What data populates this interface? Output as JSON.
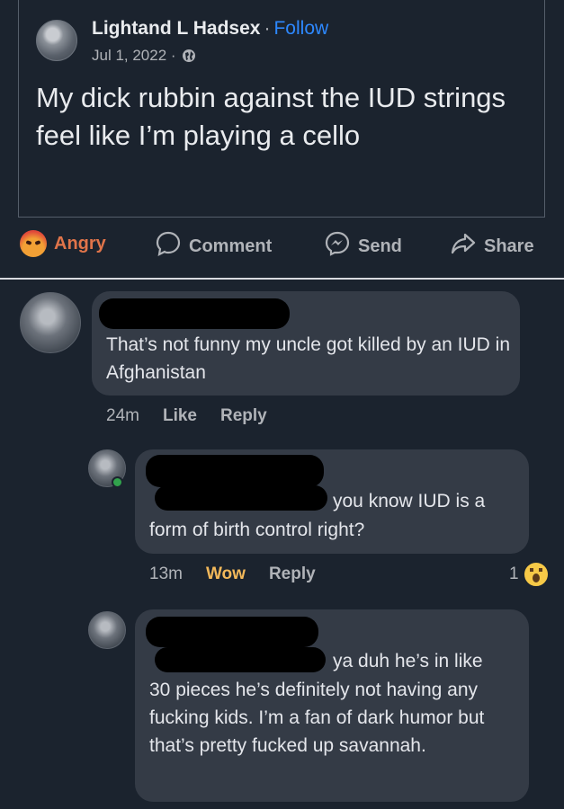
{
  "post": {
    "author": "Lightand L Hadsex",
    "separator": "·",
    "follow": "Follow",
    "date": "Jul 1, 2022 ·",
    "text": "My dick rubbin against the IUD strings feel like I’m playing a cello"
  },
  "actions": {
    "angry": "Angry",
    "comment": "Comment",
    "send": "Send",
    "share": "Share"
  },
  "comments": [
    {
      "text": "That’s not funny my uncle got killed by an IUD in Afghanistan",
      "time": "24m",
      "like": "Like",
      "reply": "Reply"
    },
    {
      "text_line1": "you know IUD is a",
      "text_line2": "form of birth control right?",
      "time": "13m",
      "reaction": "Wow",
      "reply": "Reply",
      "reaction_count": "1"
    },
    {
      "text_line1": "ya duh he’s in like",
      "text_rest": "30 pieces he’s definitely not having any fucking kids. I’m a fan of dark humor but that’s pretty fucked up savannah."
    }
  ],
  "colors": {
    "background": "#1b232e",
    "bubble": "#343b46",
    "link_blue": "#2d88ff",
    "angry_orange": "#e0744a",
    "wow_yellow": "#f2b85a"
  }
}
